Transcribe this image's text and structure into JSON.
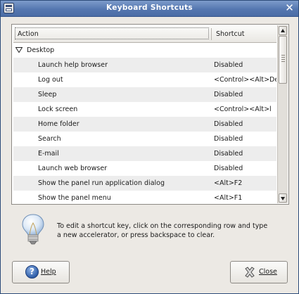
{
  "window": {
    "title": "Keyboard Shortcuts",
    "close_glyph": "✕"
  },
  "list": {
    "columns": {
      "action": "Action",
      "shortcut": "Shortcut"
    },
    "group": {
      "label": "Desktop",
      "expanded": true
    },
    "rows": [
      {
        "action": "Launch help browser",
        "shortcut": "Disabled"
      },
      {
        "action": "Log out",
        "shortcut": "<Control><Alt>Dele"
      },
      {
        "action": "Sleep",
        "shortcut": "Disabled"
      },
      {
        "action": "Lock screen",
        "shortcut": "<Control><Alt>l"
      },
      {
        "action": "Home folder",
        "shortcut": "Disabled"
      },
      {
        "action": "Search",
        "shortcut": "Disabled"
      },
      {
        "action": "E-mail",
        "shortcut": "Disabled"
      },
      {
        "action": "Launch web browser",
        "shortcut": "Disabled"
      },
      {
        "action": "Show the panel run application dialog",
        "shortcut": "<Alt>F2"
      },
      {
        "action": "Show the panel menu",
        "shortcut": "<Alt>F1"
      }
    ]
  },
  "info": {
    "icon": "lightbulb-icon",
    "text": "To edit a shortcut key, click on the corresponding row and type a new accelerator, or press backspace to clear."
  },
  "buttons": {
    "help_label": "Help",
    "help_icon": "help-icon",
    "close_label": "Close",
    "close_icon": "close-icon"
  }
}
